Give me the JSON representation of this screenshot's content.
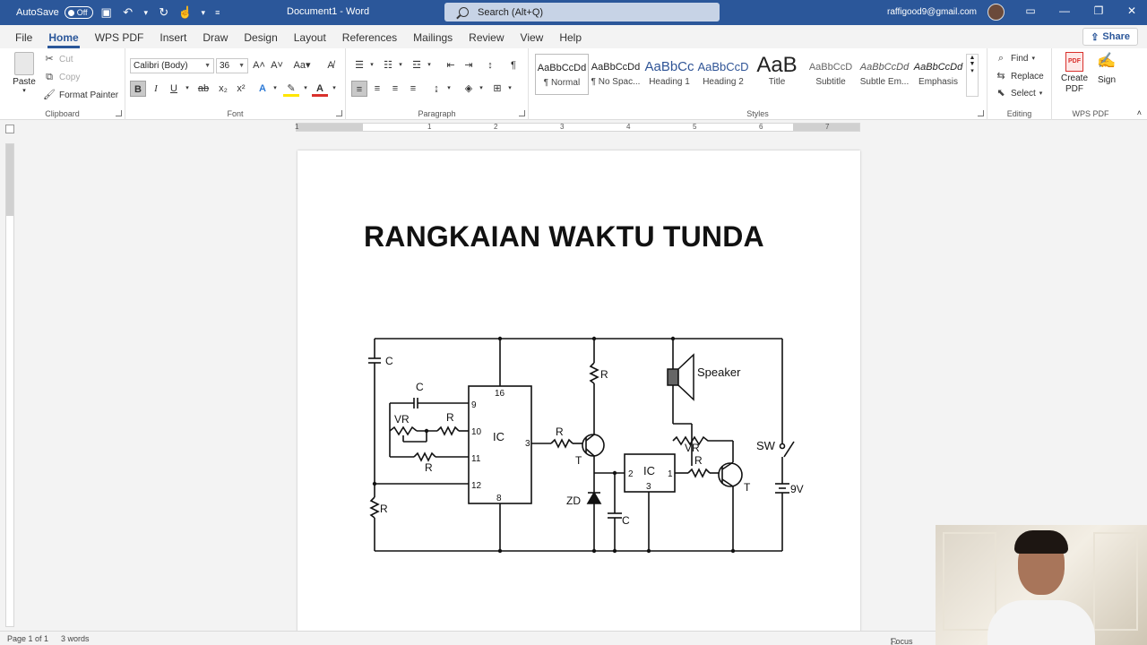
{
  "titlebar": {
    "autosave_label": "AutoSave",
    "autosave_state": "Off",
    "doc_title": "Document1  -  Word",
    "search_placeholder": "Search (Alt+Q)",
    "account": "raffigood9@gmail.com"
  },
  "tabs": [
    "File",
    "Home",
    "WPS PDF",
    "Insert",
    "Draw",
    "Design",
    "Layout",
    "References",
    "Mailings",
    "Review",
    "View",
    "Help"
  ],
  "active_tab": "Home",
  "share_label": "Share",
  "clipboard": {
    "paste": "Paste",
    "cut": "Cut",
    "copy": "Copy",
    "format_painter": "Format Painter",
    "label": "Clipboard"
  },
  "font": {
    "family": "Calibri (Body)",
    "size": "36",
    "label": "Font"
  },
  "paragraph": {
    "label": "Paragraph"
  },
  "styles": {
    "label": "Styles",
    "items": [
      {
        "preview": "AaBbCcDd",
        "name": "¶ Normal"
      },
      {
        "preview": "AaBbCcDd",
        "name": "¶ No Spac..."
      },
      {
        "preview": "AaBbCc",
        "name": "Heading 1"
      },
      {
        "preview": "AaBbCcD",
        "name": "Heading 2"
      },
      {
        "preview": "AaB",
        "name": "Title"
      },
      {
        "preview": "AaBbCcD",
        "name": "Subtitle"
      },
      {
        "preview": "AaBbCcDd",
        "name": "Subtle Em..."
      },
      {
        "preview": "AaBbCcDd",
        "name": "Emphasis"
      }
    ]
  },
  "editing": {
    "find": "Find",
    "replace": "Replace",
    "select": "Select",
    "label": "Editing"
  },
  "wps": {
    "create_pdf": "Create PDF",
    "sign": "Sign",
    "label": "WPS PDF"
  },
  "ruler_numbers": [
    "1",
    "1",
    "2",
    "3",
    "4",
    "5",
    "6",
    "7"
  ],
  "document": {
    "heading": "RANGKAIAN WAKTU TUNDA",
    "circuit_labels": {
      "c1": "C",
      "c2": "C",
      "c3": "C",
      "vr1": "VR",
      "vr2": "VR",
      "r1": "R",
      "r2": "R",
      "r3": "R",
      "r4": "R",
      "r5": "R",
      "r6": "R",
      "ic1": "IC",
      "ic2": "IC",
      "t1": "T",
      "t2": "T",
      "zd": "ZD",
      "speaker": "Speaker",
      "sw": "SW",
      "battery": "9V",
      "pin16": "16",
      "pin9": "9",
      "pin10": "10",
      "pin11": "11",
      "pin12": "12",
      "pin8": "8",
      "pin3": "3",
      "ic2_pin2": "2",
      "ic2_pin3": "3",
      "ic2_pin1": "1"
    }
  },
  "statusbar": {
    "page": "Page 1 of 1",
    "words": "3 words",
    "focus": "Focus"
  },
  "colors": {
    "accent": "#2b579a",
    "ribbon_bg": "#ffffff",
    "canvas_bg": "#f3f3f3"
  }
}
